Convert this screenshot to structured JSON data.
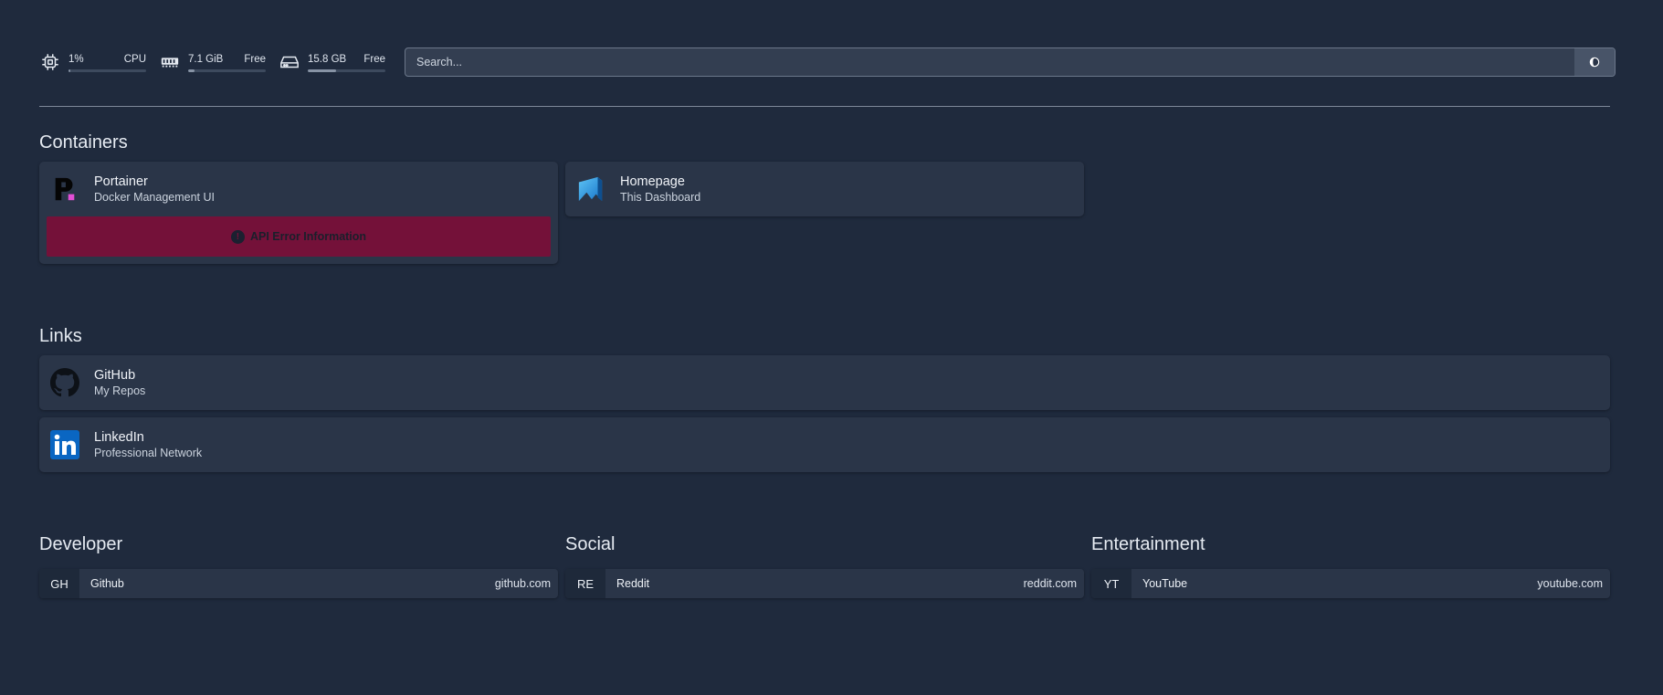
{
  "resources": {
    "cpu": {
      "value": "1%",
      "label": "CPU",
      "usage_fraction": 0.01
    },
    "memory": {
      "value": "7.1 GiB",
      "label": "Free",
      "usage_fraction": 0.08
    },
    "disk": {
      "value": "15.8 GB",
      "label": "Free",
      "usage_fraction": 0.36
    }
  },
  "search": {
    "placeholder": "Search..."
  },
  "containers": {
    "title": "Containers",
    "services": [
      {
        "name": "Portainer",
        "description": "Docker Management UI",
        "error": "API Error Information",
        "icon": "portainer-icon"
      },
      {
        "name": "Homepage",
        "description": "This Dashboard",
        "icon": "homepage-icon"
      }
    ]
  },
  "links": {
    "title": "Links",
    "items": [
      {
        "name": "GitHub",
        "description": "My Repos",
        "icon": "github-icon"
      },
      {
        "name": "LinkedIn",
        "description": "Professional Network",
        "icon": "linkedin-icon"
      }
    ]
  },
  "bookmarks": [
    {
      "title": "Developer",
      "items": [
        {
          "abbr": "GH",
          "name": "Github",
          "url": "github.com"
        }
      ]
    },
    {
      "title": "Social",
      "items": [
        {
          "abbr": "RE",
          "name": "Reddit",
          "url": "reddit.com"
        }
      ]
    },
    {
      "title": "Entertainment",
      "items": [
        {
          "abbr": "YT",
          "name": "YouTube",
          "url": "youtube.com"
        }
      ]
    }
  ],
  "colors": {
    "background": "#1f2a3d",
    "card": "#2a3548",
    "error": "#741139",
    "portainer_accent": "#e34fd6",
    "linkedin_blue": "#0a66c2"
  }
}
